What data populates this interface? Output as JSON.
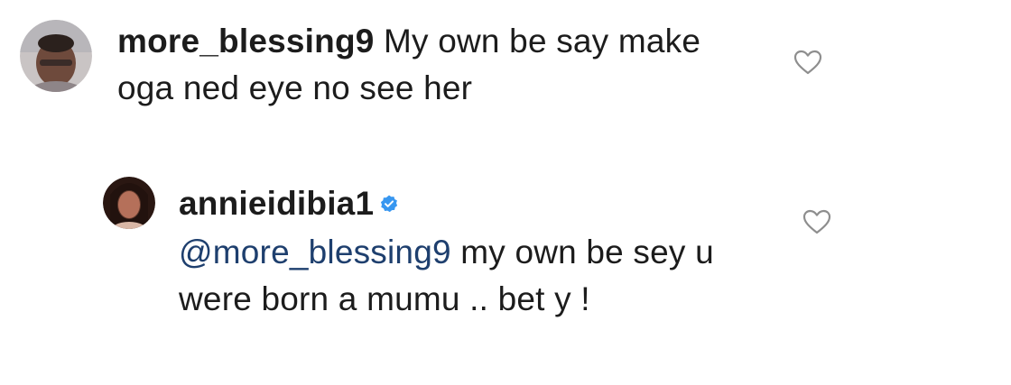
{
  "comments": [
    {
      "username": "more_blessing9",
      "text": " My own be say make oga ned eye no see her",
      "like_icon": "heart-outline-icon"
    }
  ],
  "reply": {
    "username": "annieidibia1",
    "verified_icon": "verified-badge-icon",
    "verified_color": "#3897f0",
    "mention": "@more_blessing9",
    "text": " my own be sey u were born a mumu .. bet y !",
    "like_icon": "heart-outline-icon"
  },
  "colors": {
    "text": "#1c1c1c",
    "mention": "#1e3f6e",
    "heart_outline": "#8e8e8e"
  }
}
